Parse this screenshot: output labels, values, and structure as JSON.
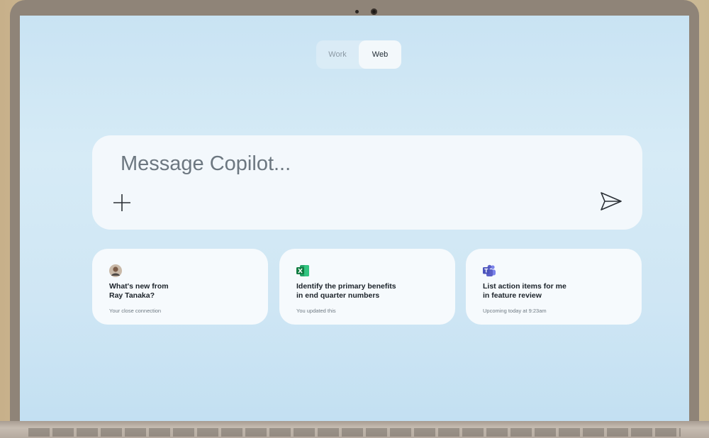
{
  "toggle": {
    "work_label": "Work",
    "web_label": "Web",
    "selected": "Web"
  },
  "composer": {
    "placeholder": "Message Copilot..."
  },
  "cards": [
    {
      "icon": "person-avatar-icon",
      "title": "What's new from\nRay Tanaka?",
      "subtitle": "Your close connection"
    },
    {
      "icon": "excel-icon",
      "title": "Identify the primary benefits\nin end quarter numbers",
      "subtitle": "You updated this"
    },
    {
      "icon": "teams-icon",
      "title": "List action items for me\nin feature review",
      "subtitle": "Upcoming today at 9:23am"
    }
  ],
  "colors": {
    "excel": "#1d7a45",
    "teams": "#5b5fc7",
    "screen": "#d6ebf6"
  }
}
